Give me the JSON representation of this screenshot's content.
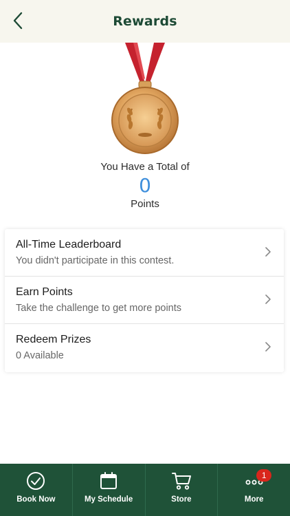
{
  "header": {
    "title": "Rewards",
    "back_icon": "chevron-left-icon"
  },
  "summary": {
    "total_label": "You Have a Total of",
    "points": "0",
    "points_label": "Points"
  },
  "menu": [
    {
      "title": "All-Time Leaderboard",
      "subtitle": "You didn't participate in this contest."
    },
    {
      "title": "Earn Points",
      "subtitle": "Take the challenge to get more points"
    },
    {
      "title": "Redeem Prizes",
      "subtitle": "0 Available"
    }
  ],
  "tabs": [
    {
      "label": "Book Now",
      "icon": "check-circle-icon"
    },
    {
      "label": "My Schedule",
      "icon": "calendar-icon"
    },
    {
      "label": "Store",
      "icon": "cart-icon"
    },
    {
      "label": "More",
      "icon": "more-dots-icon",
      "badge": "1"
    }
  ],
  "colors": {
    "brand_green": "#1f5238",
    "header_bg": "#f7f6ee",
    "points_blue": "#3f8fdc",
    "badge_red": "#d9261c"
  }
}
